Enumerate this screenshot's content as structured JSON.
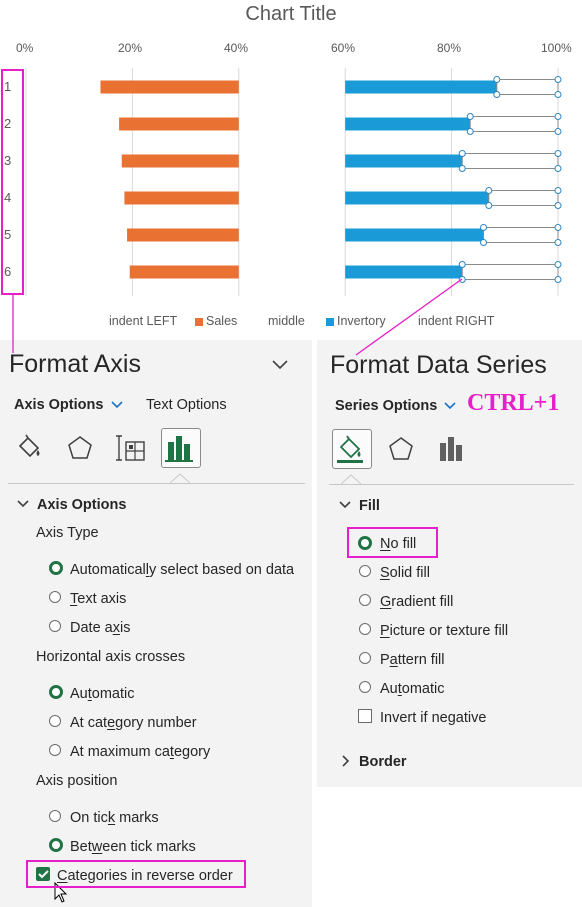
{
  "chart": {
    "title": "Chart Title",
    "ticks": [
      "0%",
      "20%",
      "40%",
      "60%",
      "80%",
      "100%"
    ],
    "categories": [
      "1",
      "2",
      "3",
      "4",
      "5",
      "6"
    ],
    "legend": [
      "indent LEFT",
      "Sales",
      "middle",
      "Invertory",
      "indent RIGHT"
    ],
    "colors": {
      "sales": "#e97132",
      "inventory": "#1a9bd7",
      "accent": "#e61ecb",
      "handles": "#2e86c1"
    }
  },
  "chart_data": {
    "type": "bar",
    "orientation": "horizontal",
    "stacked": "percent",
    "title": "Chart Title",
    "xlim": [
      0,
      100
    ],
    "x_ticks": [
      "0%",
      "20%",
      "40%",
      "60%",
      "80%",
      "100%"
    ],
    "categories": [
      "1",
      "2",
      "3",
      "4",
      "5",
      "6"
    ],
    "legend_position": "bottom",
    "series": [
      {
        "name": "indent LEFT",
        "values": [
          14,
          17.5,
          18,
          18.5,
          19,
          19.5
        ],
        "fill": "none"
      },
      {
        "name": "Sales",
        "values": [
          26,
          22.5,
          22,
          21.5,
          21,
          20.5
        ]
      },
      {
        "name": "middle",
        "values": [
          20,
          20,
          20,
          20,
          20,
          20
        ],
        "fill": "none"
      },
      {
        "name": "Invertory",
        "values": [
          28.5,
          23.5,
          22,
          27,
          26,
          22
        ]
      },
      {
        "name": "indent RIGHT",
        "values": [
          11.5,
          16.5,
          18,
          13,
          14,
          18
        ],
        "fill": "none"
      }
    ]
  },
  "left_pane": {
    "title": "Format Axis",
    "tab_active": "Axis Options",
    "tab_other": "Text Options",
    "section": "Axis Options",
    "axis_type_label": "Axis Type",
    "axis_type_options": [
      "Automatically select based on data",
      "Text axis",
      "Date axis"
    ],
    "crosses_label": "Horizontal axis crosses",
    "crosses_options": [
      "Automatic",
      "At category number",
      "At maximum category"
    ],
    "position_label": "Axis position",
    "position_options": [
      "On tick marks",
      "Between tick marks"
    ],
    "reverse_label": "Categories in reverse order"
  },
  "right_pane": {
    "title": "Format Data Series",
    "tab_active": "Series Options",
    "shortcut": "CTRL+1",
    "fill_section": "Fill",
    "fill_options": [
      "No fill",
      "Solid fill",
      "Gradient fill",
      "Picture or texture fill",
      "Pattern fill",
      "Automatic"
    ],
    "invert_label": "Invert if negative",
    "border_section": "Border"
  }
}
